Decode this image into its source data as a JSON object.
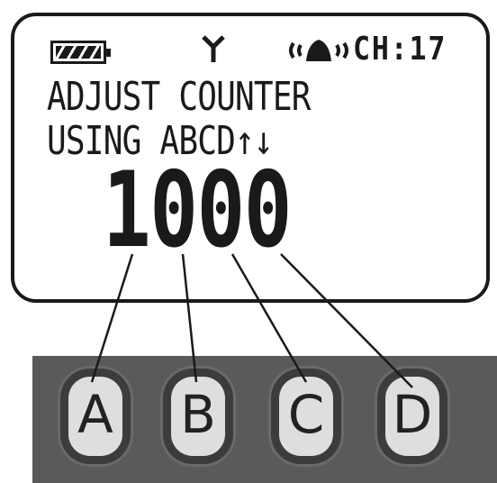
{
  "status_bar": {
    "battery_icon": "battery-icon",
    "battery_level": 1.0,
    "signal_icon": "antenna-icon",
    "alert_icon": "bell-alert-icon",
    "channel_label": "CH:17"
  },
  "screen": {
    "line1": "ADJUST COUNTER",
    "line2": "USING ABCD↑↓",
    "counter_digits": [
      "1",
      "0",
      "0",
      "0"
    ]
  },
  "keypad": {
    "keys": [
      {
        "label": "A"
      },
      {
        "label": "B"
      },
      {
        "label": "C"
      },
      {
        "label": "D"
      }
    ]
  },
  "colors": {
    "lcd_ink": "#1a1a1a",
    "lcd_background": "#ffffff",
    "keypad_background": "#5a5a5a",
    "key_face": "#dedede"
  }
}
